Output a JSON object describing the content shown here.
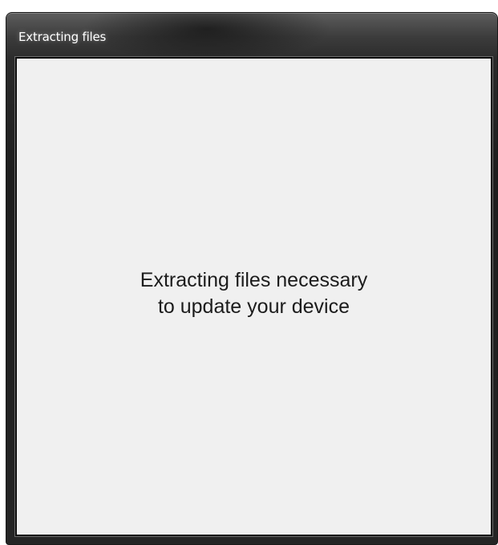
{
  "window": {
    "title": "Extracting files"
  },
  "dialog": {
    "message_line1": "Extracting files necessary",
    "message_line2": "to update your device"
  },
  "colors": {
    "titlebar": "#2a2a2a",
    "client_background": "#f0f0f0",
    "text": "#1c1c1c"
  }
}
